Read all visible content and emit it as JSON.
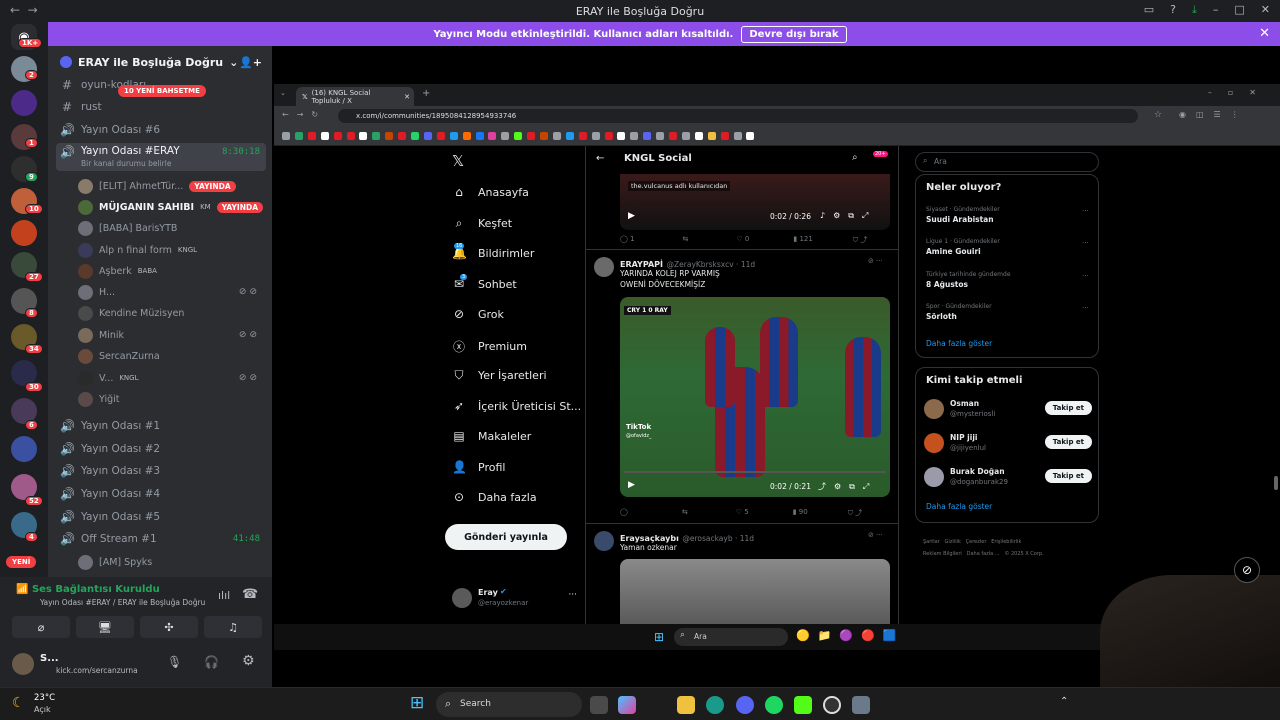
{
  "window": {
    "title": "ERAY ile Boşluğa Doğru"
  },
  "banner": {
    "text": "Yayıncı Modu etkinleştirildi. Kullanıcı adları kısaltıldı.",
    "button": "Devre dışı bırak"
  },
  "rail": {
    "top_badge": "1K+",
    "new_label": "YENİ",
    "badges": [
      "2",
      "1",
      "9",
      "10",
      "27",
      "8",
      "34",
      "30",
      "6",
      "52",
      "4"
    ]
  },
  "guild": {
    "name": "ERAY ile Boşluğa Doğru",
    "new_mentions": "10 YENİ BAHSETME"
  },
  "channels": {
    "oyun_kodlar": "oyun-kodları",
    "rust": "rust",
    "yayin6": "Yayın Odası #6",
    "active": {
      "name": "Yayın Odası #ERAY",
      "timer": "8:30:18",
      "status": "Bir kanal durumu belirle"
    },
    "yayin1": "Yayın Odası #1",
    "yayin2": "Yayın Odası #2",
    "yayin3": "Yayın Odası #3",
    "yayin4": "Yayın Odası #4",
    "yayin5": "Yayın Odası #5",
    "offstream": {
      "name": "Off Stream #1",
      "timer": "41:48"
    },
    "offstream_user": "[AM] Spyks"
  },
  "voice_users": [
    {
      "name": "[ELIT] AhmetTür...",
      "badge": "YAYINDA"
    },
    {
      "name": "MÜJGANIN SAHIBI",
      "tag": "KM",
      "badge": "YAYINDA"
    },
    {
      "name": "[BABA] BarisYTB"
    },
    {
      "name": "Alp n final form",
      "tag": "KNGL"
    },
    {
      "name": "Aşberk",
      "tag": "BABA"
    },
    {
      "name": "H..."
    },
    {
      "name": "Kendine Müzisyen"
    },
    {
      "name": "Minik"
    },
    {
      "name": "SercanZurna"
    },
    {
      "name": "V...",
      "tag": "KNGL"
    },
    {
      "name": "Yiğit"
    }
  ],
  "voice_panel": {
    "status": "Ses Bağlantısı Kuruldu",
    "location": "Yayın Odası #ERAY / ERAY ile Boşluğa Doğru",
    "me_name": "S...",
    "me_sub": "kick.com/sercanzurna"
  },
  "weather": {
    "temp": "23°C",
    "desc": "Açık"
  },
  "browser": {
    "tab_title": "(16) KNGL Social Topluluk / X",
    "url": "x.com/i/communities/1895084128954933746"
  },
  "xnav": [
    "Anasayfa",
    "Keşfet",
    "Bildirimler",
    "Sohbet",
    "Grok",
    "Premium",
    "Yer İşaretleri",
    "İçerik Üreticisi St...",
    "Makaleler",
    "Profil",
    "Daha fazla"
  ],
  "xnav_badges": {
    "notifications": "16",
    "messages": "3"
  },
  "post_button": "Gönderi yayınla",
  "account": {
    "name": "Eray",
    "handle": "@erayozkenar"
  },
  "feed": {
    "title": "KNGL Social",
    "title_badge": "20+",
    "video1": {
      "caption": "the.vulcanus adlı kullanıcıdan",
      "time": "0:02 / 0:26",
      "replies": "1",
      "likes": "0",
      "views": "121"
    },
    "tweet2": {
      "name": "ERAYPAPİ",
      "handle": "@ZerayKbrsksxcv · 11d",
      "text1": "YARINDA KOLEJ RP VARMIŞ",
      "text2": "OWENİ DÖVECEKMİŞİZ",
      "score": "CRY 1 0 RAY",
      "watermark": "TikTok",
      "wm_handle": "@ofavidz_",
      "time": "0:02 / 0:21",
      "likes": "5",
      "views": "90"
    },
    "tweet3": {
      "name": "Eraysaçkaybı",
      "handle": "@erosackayb · 11d",
      "text": "Yaman ozkenar"
    }
  },
  "search": {
    "placeholder": "Ara"
  },
  "trending": {
    "title": "Neler oluyor?",
    "items": [
      {
        "cat": "Siyaset · Gündemdekiler",
        "topic": "Suudi Arabistan"
      },
      {
        "cat": "Ligue 1 · Gündemdekiler",
        "topic": "Amine Gouiri"
      },
      {
        "cat": "Türkiye tarihinde gündemde",
        "topic": "8 Ağustos"
      },
      {
        "cat": "Spor · Gündemdekiler",
        "topic": "Sörloth"
      }
    ],
    "more": "Daha fazla göster"
  },
  "who_to_follow": {
    "title": "Kimi takip etmeli",
    "items": [
      {
        "name": "Osman",
        "handle": "@mysteriosli",
        "button": "Takip et"
      },
      {
        "name": "NIP jiji",
        "handle": "@jijiyenlul",
        "button": "Takip et"
      },
      {
        "name": "Burak Doğan",
        "handle": "@doganburak29",
        "button": "Takip et"
      }
    ],
    "more": "Daha fazla göster"
  },
  "footer_links": [
    "Şartlar",
    "Gizlilik",
    "Çerezler",
    "Erişilebilirlik",
    "Reklam Bilgileri",
    "Daha fazla ...",
    "© 2025 X Corp."
  ],
  "inner_taskbar": {
    "search": "Ara"
  },
  "taskbar": {
    "search": "Search"
  },
  "colors": {
    "discord_bg": "#2b2d31",
    "banner": "#8c4de8",
    "live": "#f23f43",
    "online": "#23a55a",
    "x_blue": "#1d9bf0"
  }
}
